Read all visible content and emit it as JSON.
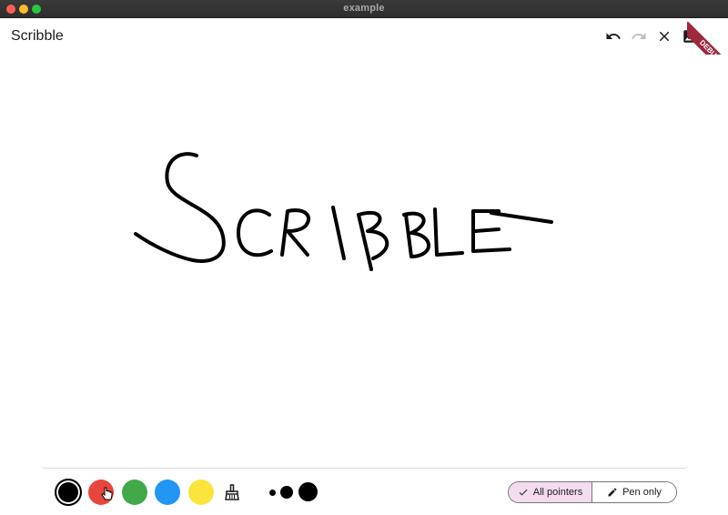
{
  "window": {
    "title": "example"
  },
  "appbar": {
    "title": "Scribble",
    "actions": [
      {
        "name": "undo",
        "icon": "undo-icon",
        "enabled": true
      },
      {
        "name": "redo",
        "icon": "redo-icon",
        "enabled": false
      },
      {
        "name": "clear",
        "icon": "close-icon",
        "enabled": true
      },
      {
        "name": "image",
        "icon": "image-icon",
        "enabled": true
      }
    ],
    "debug_banner": "DEBUG"
  },
  "canvas": {
    "drawing_text": "SCRIBBLE",
    "stroke_color": "#000000"
  },
  "toolbar": {
    "colors": [
      {
        "name": "black",
        "hex": "#000000",
        "selected": true
      },
      {
        "name": "red",
        "hex": "#e8453c",
        "selected": false
      },
      {
        "name": "green",
        "hex": "#43a84a",
        "selected": false
      },
      {
        "name": "blue",
        "hex": "#2196f3",
        "selected": false
      },
      {
        "name": "yellow",
        "hex": "#fbe43b",
        "selected": false
      }
    ],
    "eraser_icon": "broom-icon",
    "stroke_widths": [
      "small",
      "medium",
      "large"
    ],
    "pointer_mode": {
      "options": [
        {
          "label": "All pointers",
          "icon": "check-icon",
          "selected": true
        },
        {
          "label": "Pen only",
          "icon": "pen-icon",
          "selected": false
        }
      ]
    }
  }
}
